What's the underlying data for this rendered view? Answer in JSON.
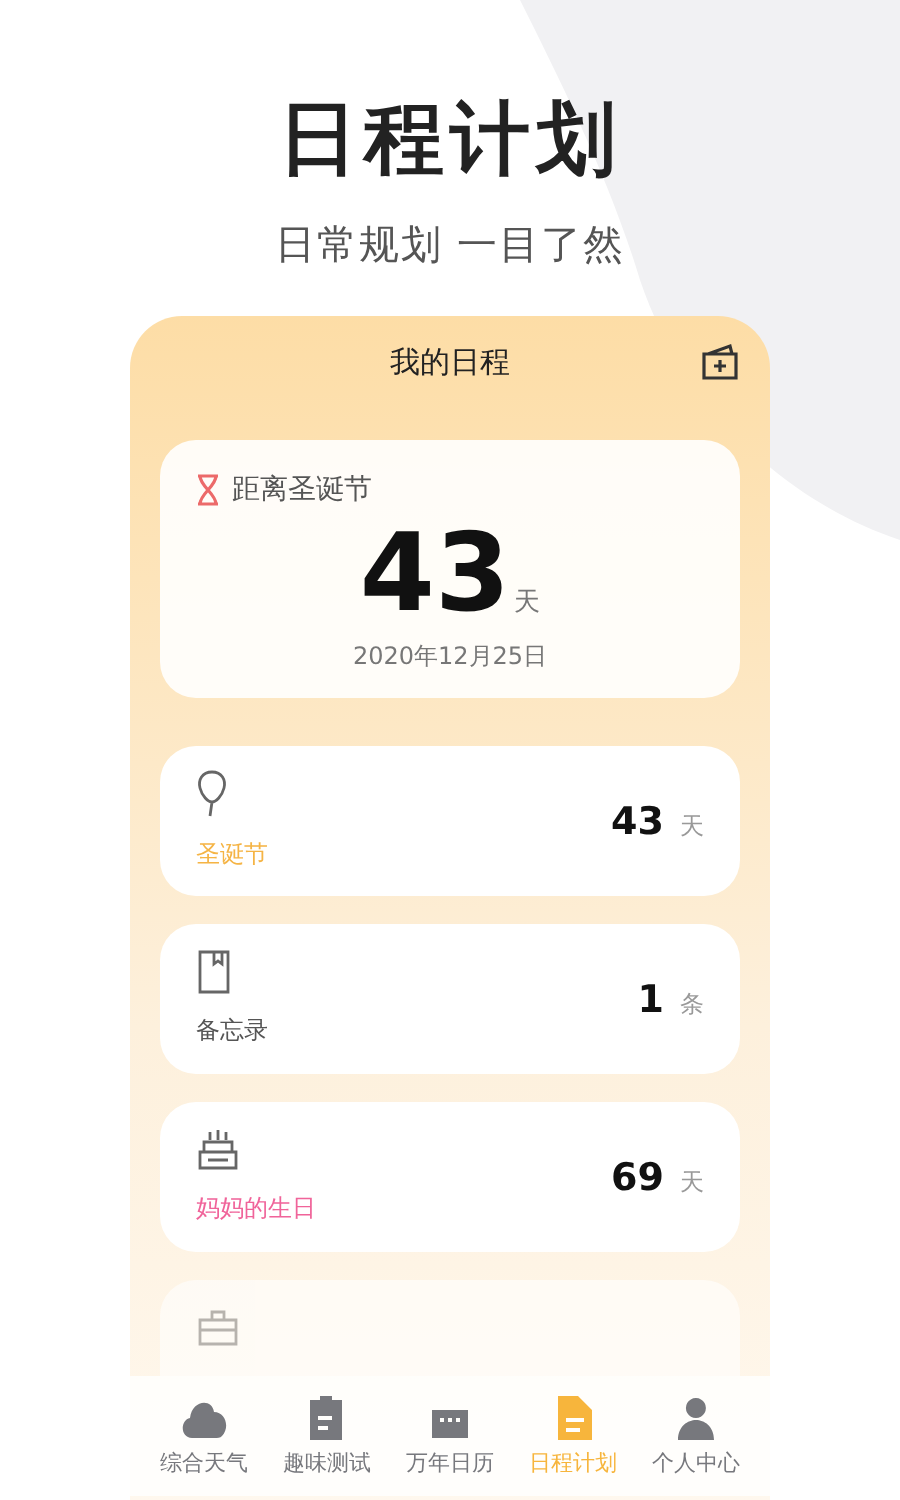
{
  "headline": "日程计划",
  "subtitle": "日常规划 一目了然",
  "screen": {
    "title": "我的日程",
    "countdown": {
      "label": "距离圣诞节",
      "value": "43",
      "unit": "天",
      "date": "2020年12月25日"
    },
    "events": [
      {
        "kind": "balloon",
        "name": "圣诞节",
        "color": "#f5b445",
        "value": "43",
        "unit": "天"
      },
      {
        "kind": "book",
        "name": "备忘录",
        "color": "#555555",
        "value": "1",
        "unit": "条"
      },
      {
        "kind": "cake",
        "name": "妈妈的生日",
        "color": "#f0649a",
        "value": "69",
        "unit": "天"
      },
      {
        "kind": "briefcase"
      }
    ]
  },
  "tabs": [
    {
      "kind": "cloud",
      "label": "综合天气",
      "selected": false
    },
    {
      "kind": "clipboard",
      "label": "趣味测试",
      "selected": false
    },
    {
      "kind": "calendar",
      "label": "万年日历",
      "selected": false
    },
    {
      "kind": "doc",
      "label": "日程计划",
      "selected": true
    },
    {
      "kind": "person",
      "label": "个人中心",
      "selected": false
    }
  ]
}
